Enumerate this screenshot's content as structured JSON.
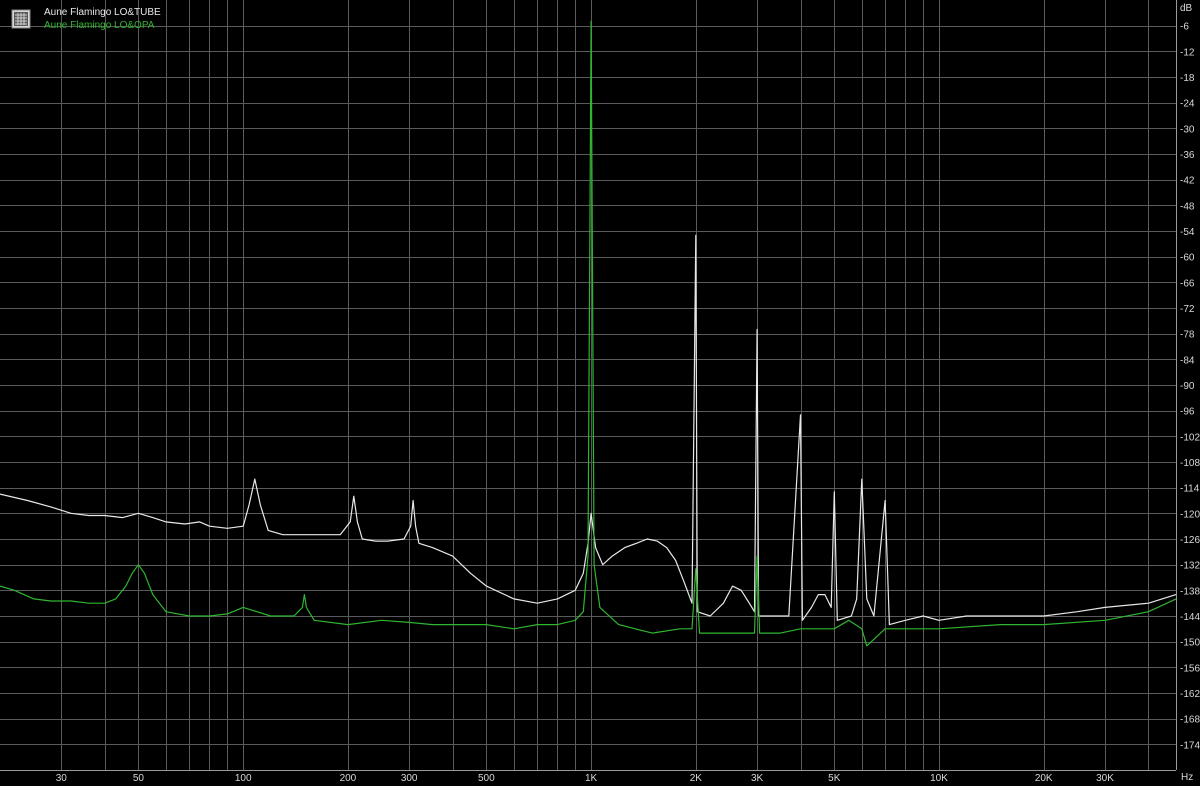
{
  "chart_data": {
    "type": "line",
    "x_scale": "log",
    "xlim": [
      20,
      48000
    ],
    "ylim": [
      -180,
      0
    ],
    "y_unit": "dB",
    "x_unit": "Hz",
    "grid": true,
    "legend_position": "top-left",
    "x_ticks": [
      {
        "value": 30,
        "label": "30"
      },
      {
        "value": 50,
        "label": "50"
      },
      {
        "value": 100,
        "label": "100"
      },
      {
        "value": 200,
        "label": "200"
      },
      {
        "value": 300,
        "label": "300"
      },
      {
        "value": 500,
        "label": "500"
      },
      {
        "value": 1000,
        "label": "1K"
      },
      {
        "value": 2000,
        "label": "2K"
      },
      {
        "value": 3000,
        "label": "3K"
      },
      {
        "value": 5000,
        "label": "5K"
      },
      {
        "value": 10000,
        "label": "10K"
      },
      {
        "value": 20000,
        "label": "20K"
      },
      {
        "value": 30000,
        "label": "30K"
      }
    ],
    "y_ticks": [
      -6,
      -12,
      -18,
      -24,
      -30,
      -36,
      -42,
      -48,
      -54,
      -60,
      -66,
      -72,
      -78,
      -84,
      -90,
      -96,
      -102,
      -108,
      -114,
      -120,
      -126,
      -132,
      -138,
      -144,
      -150,
      -156,
      -162,
      -168,
      -174
    ],
    "series": [
      {
        "name": "Aune Flamingo LO&TUBE",
        "color": "#e8e8e8",
        "points": [
          [
            20,
            -115.5
          ],
          [
            24,
            -117
          ],
          [
            28,
            -118.5
          ],
          [
            32,
            -120
          ],
          [
            36,
            -120.5
          ],
          [
            40,
            -120.5
          ],
          [
            45,
            -121
          ],
          [
            50,
            -120
          ],
          [
            55,
            -121
          ],
          [
            60,
            -122
          ],
          [
            68,
            -122.5
          ],
          [
            75,
            -122
          ],
          [
            80,
            -123
          ],
          [
            90,
            -123.5
          ],
          [
            100,
            -123
          ],
          [
            104,
            -118
          ],
          [
            108,
            -112
          ],
          [
            112,
            -118
          ],
          [
            118,
            -124
          ],
          [
            130,
            -125
          ],
          [
            150,
            -125
          ],
          [
            170,
            -125
          ],
          [
            190,
            -125
          ],
          [
            203,
            -122
          ],
          [
            208,
            -116
          ],
          [
            213,
            -122
          ],
          [
            220,
            -126
          ],
          [
            240,
            -126.5
          ],
          [
            260,
            -126.5
          ],
          [
            290,
            -126
          ],
          [
            303,
            -123
          ],
          [
            308,
            -117
          ],
          [
            313,
            -123
          ],
          [
            320,
            -127
          ],
          [
            350,
            -128
          ],
          [
            400,
            -130
          ],
          [
            450,
            -134
          ],
          [
            500,
            -137
          ],
          [
            600,
            -140
          ],
          [
            700,
            -141
          ],
          [
            800,
            -140
          ],
          [
            900,
            -138
          ],
          [
            950,
            -134
          ],
          [
            980,
            -127
          ],
          [
            1000,
            -120
          ],
          [
            1030,
            -128
          ],
          [
            1080,
            -132
          ],
          [
            1150,
            -130
          ],
          [
            1250,
            -128
          ],
          [
            1350,
            -127
          ],
          [
            1450,
            -126
          ],
          [
            1550,
            -126.5
          ],
          [
            1650,
            -128
          ],
          [
            1750,
            -131
          ],
          [
            1850,
            -136
          ],
          [
            1950,
            -141
          ],
          [
            2000,
            -55
          ],
          [
            2020,
            -143
          ],
          [
            2200,
            -144
          ],
          [
            2400,
            -141
          ],
          [
            2550,
            -137
          ],
          [
            2700,
            -138
          ],
          [
            2850,
            -141
          ],
          [
            2950,
            -143
          ],
          [
            3000,
            -77
          ],
          [
            3030,
            -144
          ],
          [
            3400,
            -144
          ],
          [
            3700,
            -144
          ],
          [
            4000,
            -97
          ],
          [
            4050,
            -145
          ],
          [
            4300,
            -142
          ],
          [
            4500,
            -139
          ],
          [
            4700,
            -139
          ],
          [
            4900,
            -142
          ],
          [
            5000,
            -115
          ],
          [
            5100,
            -145
          ],
          [
            5600,
            -144
          ],
          [
            5800,
            -140
          ],
          [
            6000,
            -112
          ],
          [
            6200,
            -140
          ],
          [
            6500,
            -144
          ],
          [
            7000,
            -117
          ],
          [
            7200,
            -146
          ],
          [
            8000,
            -145
          ],
          [
            9000,
            -144
          ],
          [
            10000,
            -145
          ],
          [
            12000,
            -144
          ],
          [
            15000,
            -144
          ],
          [
            20000,
            -144
          ],
          [
            25000,
            -143
          ],
          [
            30000,
            -142
          ],
          [
            40000,
            -141
          ],
          [
            48000,
            -139
          ]
        ]
      },
      {
        "name": "Aune Flamingo LO&OPA",
        "color": "#2fb52f",
        "points": [
          [
            20,
            -137
          ],
          [
            22,
            -138
          ],
          [
            25,
            -140
          ],
          [
            28,
            -140.5
          ],
          [
            32,
            -140.5
          ],
          [
            36,
            -141
          ],
          [
            40,
            -141
          ],
          [
            43,
            -140
          ],
          [
            46,
            -137
          ],
          [
            48,
            -134
          ],
          [
            50,
            -132
          ],
          [
            52,
            -134
          ],
          [
            55,
            -139
          ],
          [
            60,
            -143
          ],
          [
            70,
            -144
          ],
          [
            80,
            -144
          ],
          [
            90,
            -143.5
          ],
          [
            100,
            -142
          ],
          [
            120,
            -144
          ],
          [
            140,
            -144
          ],
          [
            148,
            -142
          ],
          [
            150,
            -139
          ],
          [
            152,
            -142
          ],
          [
            160,
            -145
          ],
          [
            200,
            -146
          ],
          [
            250,
            -145
          ],
          [
            300,
            -145.5
          ],
          [
            350,
            -146
          ],
          [
            400,
            -146
          ],
          [
            500,
            -146
          ],
          [
            600,
            -147
          ],
          [
            700,
            -146
          ],
          [
            800,
            -146
          ],
          [
            900,
            -145
          ],
          [
            950,
            -143
          ],
          [
            980,
            -130
          ],
          [
            1000,
            -5
          ],
          [
            1020,
            -132
          ],
          [
            1060,
            -142
          ],
          [
            1200,
            -146
          ],
          [
            1500,
            -148
          ],
          [
            1800,
            -147
          ],
          [
            1950,
            -147
          ],
          [
            2000,
            -133
          ],
          [
            2050,
            -148
          ],
          [
            2500,
            -148
          ],
          [
            2950,
            -148
          ],
          [
            3000,
            -130
          ],
          [
            3050,
            -148
          ],
          [
            3500,
            -148
          ],
          [
            4000,
            -147
          ],
          [
            5000,
            -147
          ],
          [
            5500,
            -145
          ],
          [
            6000,
            -147
          ],
          [
            6200,
            -151
          ],
          [
            7000,
            -147
          ],
          [
            8000,
            -147
          ],
          [
            10000,
            -147
          ],
          [
            15000,
            -146
          ],
          [
            20000,
            -146
          ],
          [
            30000,
            -145
          ],
          [
            40000,
            -143
          ],
          [
            48000,
            -140
          ]
        ]
      }
    ]
  }
}
